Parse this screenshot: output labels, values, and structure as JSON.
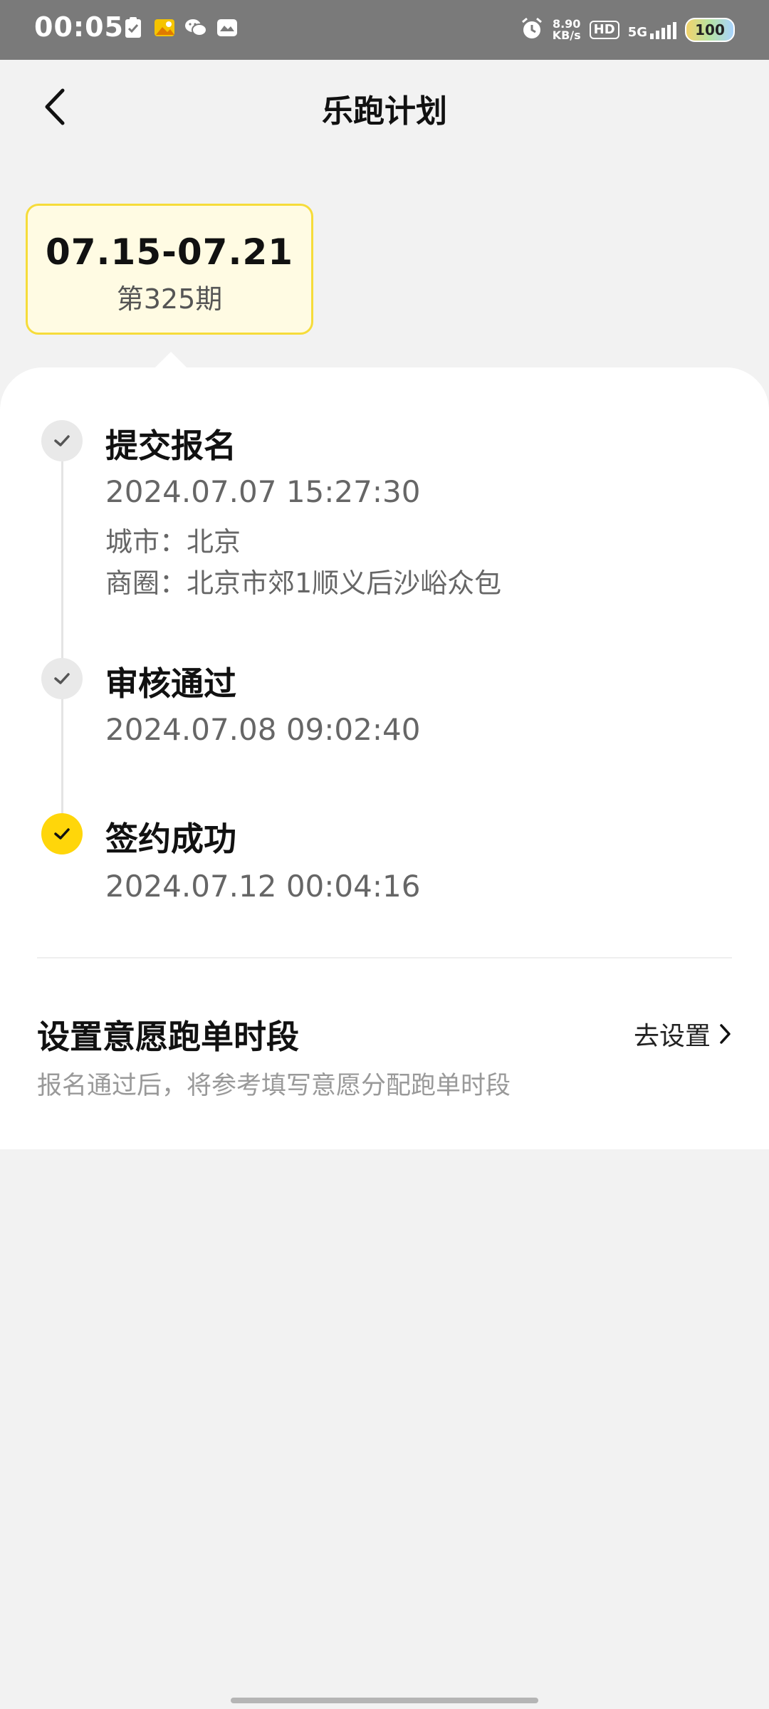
{
  "status_bar": {
    "time": "00:05",
    "net_speed_value": "8.90",
    "net_speed_unit": "KB/s",
    "hd_label": "HD",
    "network_label": "5G",
    "battery": "100",
    "left_icons": [
      "clipboard-check-icon",
      "gallery-icon",
      "wechat-icon",
      "message-icon"
    ]
  },
  "header": {
    "title": "乐跑计划"
  },
  "period": {
    "range": "07.15-07.21",
    "issue": "第325期"
  },
  "steps": [
    {
      "title": "提交报名",
      "lines": [
        "2024.07.07 15:27:30",
        "城市：北京",
        "商圈：北京市郊1顺义后沙峪众包"
      ],
      "active": false
    },
    {
      "title": "审核通过",
      "lines": [
        "2024.07.08 09:02:40"
      ],
      "active": false
    },
    {
      "title": "签约成功",
      "lines": [
        "2024.07.12 00:04:16"
      ],
      "active": true
    }
  ],
  "setting": {
    "title": "设置意愿跑单时段",
    "description": "报名通过后，将参考填写意愿分配跑单时段",
    "link_label": "去设置"
  },
  "colors": {
    "accent_yellow": "#ffd60a",
    "tab_bg": "#fffbe3",
    "tab_border": "#f6dc3a",
    "page_bg": "#f2f2f2",
    "status_bar": "#7a7a7a"
  }
}
